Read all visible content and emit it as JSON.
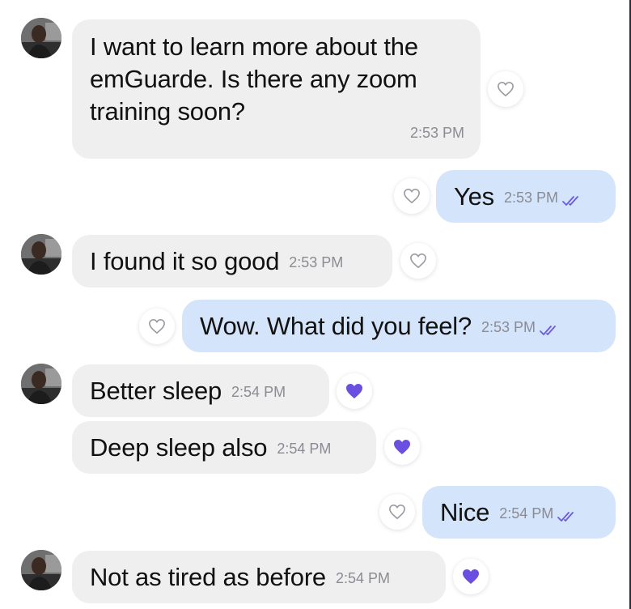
{
  "colors": {
    "incoming_bubble": "#efefef",
    "outgoing_bubble": "#d4e4fb",
    "timestamp": "#8b8b93",
    "read_ticks": "#6a5ae0",
    "liked_heart": "#6a4fe0"
  },
  "messages": [
    {
      "direction": "incoming",
      "text": "I want to learn more about the emGuarde. Is there any zoom training soon?",
      "lines": [
        "I want to learn more about the",
        "emGuarde. Is there any zoom",
        "training soon?"
      ],
      "time": "2:53 PM",
      "reaction": "heart-outline"
    },
    {
      "direction": "outgoing",
      "text": "Yes",
      "time": "2:53 PM",
      "status": "read-double-check",
      "reaction": "heart-outline"
    },
    {
      "direction": "incoming",
      "text": "I found it so good",
      "time": "2:53 PM",
      "reaction": "heart-outline"
    },
    {
      "direction": "outgoing",
      "text": "Wow. What did you feel?",
      "time": "2:53 PM",
      "status": "read-double-check",
      "reaction": "heart-outline"
    },
    {
      "direction": "incoming",
      "text": "Better sleep",
      "time": "2:54 PM",
      "reaction": "heart-filled"
    },
    {
      "direction": "incoming",
      "text": "Deep sleep also",
      "time": "2:54 PM",
      "reaction": "heart-filled"
    },
    {
      "direction": "outgoing",
      "text": "Nice",
      "time": "2:54 PM",
      "status": "read-double-check",
      "reaction": "heart-outline"
    },
    {
      "direction": "incoming",
      "text": "Not as tired as before",
      "time": "2:54 PM",
      "reaction": "heart-filled"
    }
  ]
}
